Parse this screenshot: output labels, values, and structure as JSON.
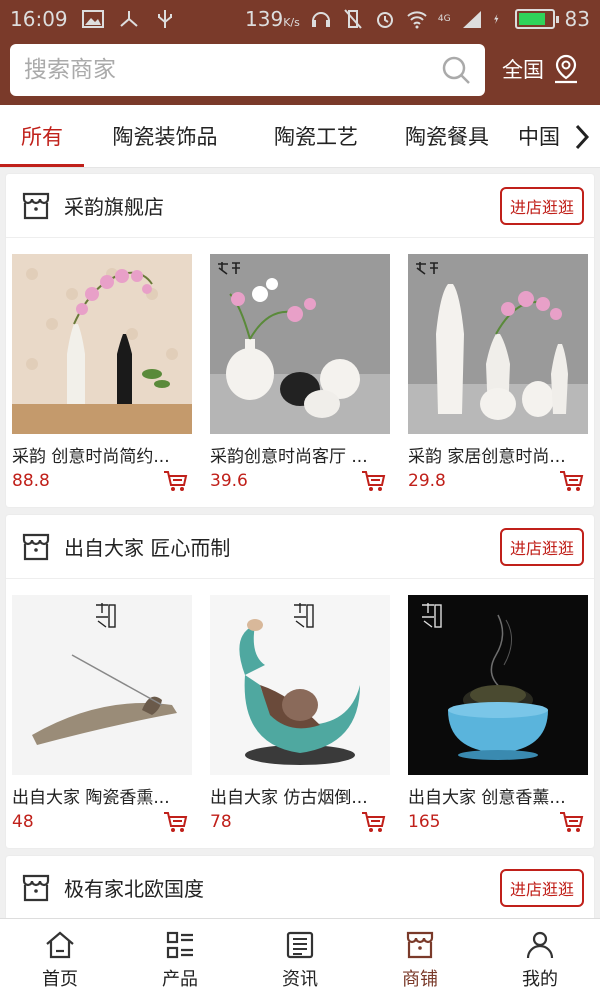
{
  "statusbar": {
    "time": "16:09",
    "speed": "139",
    "speed_unit": "K/s",
    "network": "4G",
    "battery": "83",
    "battery_level": 0.83
  },
  "search": {
    "placeholder": "搜索商家"
  },
  "region": {
    "label": "全国"
  },
  "tabs": [
    "所有",
    "陶瓷装饰品",
    "陶瓷工艺",
    "陶瓷餐具",
    "中国"
  ],
  "stores": [
    {
      "name": "采韵旗舰店",
      "button": "进店逛逛",
      "products": [
        {
          "title": "采韵 创意时尚简约...",
          "price": "88.8"
        },
        {
          "title": "采韵创意时尚客厅 ...",
          "price": "39.6"
        },
        {
          "title": "采韵 家居创意时尚...",
          "price": "29.8"
        }
      ]
    },
    {
      "name": "出自大家 匠心而制",
      "button": "进店逛逛",
      "products": [
        {
          "title": "出自大家 陶瓷香熏...",
          "price": "48"
        },
        {
          "title": "出自大家 仿古烟倒...",
          "price": "78"
        },
        {
          "title": "出自大家 创意香薰...",
          "price": "165"
        }
      ]
    },
    {
      "name": "极有家北欧国度",
      "button": "进店逛逛",
      "products": []
    }
  ],
  "bottomnav": [
    "首页",
    "产品",
    "资讯",
    "商铺",
    "我的"
  ],
  "colors": {
    "brand": "#7a3a2a",
    "accent": "#c0201a"
  }
}
